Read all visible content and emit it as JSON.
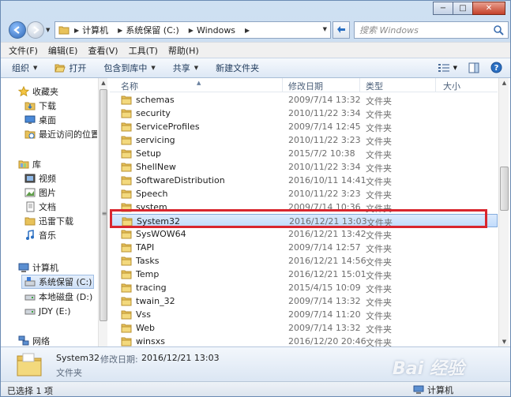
{
  "caption_buttons": {
    "minimize": "−",
    "maximize": "□",
    "close": "✕"
  },
  "address": {
    "crumbs": [
      "计算机",
      "系统保留 (C:)",
      "Windows"
    ]
  },
  "search": {
    "placeholder": "搜索 Windows"
  },
  "menubar": [
    "文件(F)",
    "编辑(E)",
    "查看(V)",
    "工具(T)",
    "帮助(H)"
  ],
  "cmdbar": {
    "organize": "组织",
    "open": "打开",
    "include": "包含到库中",
    "share": "共享",
    "new_folder": "新建文件夹"
  },
  "navpane": {
    "favorites": "收藏夹",
    "fav_items": [
      "下载",
      "桌面",
      "最近访问的位置"
    ],
    "libraries": "库",
    "lib_items": [
      "视频",
      "图片",
      "文档",
      "迅雷下载",
      "音乐"
    ],
    "computer": "计算机",
    "drives": [
      "系统保留 (C:)",
      "本地磁盘 (D:)",
      "JDY (E:)"
    ],
    "network": "网络"
  },
  "columns": {
    "name": "名称",
    "date": "修改日期",
    "type": "类型",
    "size": "大小"
  },
  "files": [
    {
      "name": "schemas",
      "date": "2009/7/14 13:32",
      "type": "文件夹"
    },
    {
      "name": "security",
      "date": "2010/11/22 3:34",
      "type": "文件夹"
    },
    {
      "name": "ServiceProfiles",
      "date": "2009/7/14 12:45",
      "type": "文件夹"
    },
    {
      "name": "servicing",
      "date": "2010/11/22 3:23",
      "type": "文件夹"
    },
    {
      "name": "Setup",
      "date": "2015/7/2 10:38",
      "type": "文件夹"
    },
    {
      "name": "ShellNew",
      "date": "2010/11/22 3:34",
      "type": "文件夹"
    },
    {
      "name": "SoftwareDistribution",
      "date": "2016/10/11 14:41",
      "type": "文件夹"
    },
    {
      "name": "Speech",
      "date": "2010/11/22 3:23",
      "type": "文件夹"
    },
    {
      "name": "system",
      "date": "2009/7/14 10:36",
      "type": "文件夹"
    },
    {
      "name": "System32",
      "date": "2016/12/21 13:03",
      "type": "文件夹"
    },
    {
      "name": "SysWOW64",
      "date": "2016/12/21 13:42",
      "type": "文件夹"
    },
    {
      "name": "TAPI",
      "date": "2009/7/14 12:57",
      "type": "文件夹"
    },
    {
      "name": "Tasks",
      "date": "2016/12/21 14:56",
      "type": "文件夹"
    },
    {
      "name": "Temp",
      "date": "2016/12/21 15:01",
      "type": "文件夹"
    },
    {
      "name": "tracing",
      "date": "2015/4/15 10:09",
      "type": "文件夹"
    },
    {
      "name": "twain_32",
      "date": "2009/7/14 13:32",
      "type": "文件夹"
    },
    {
      "name": "Vss",
      "date": "2009/7/14 11:20",
      "type": "文件夹"
    },
    {
      "name": "Web",
      "date": "2009/7/14 13:32",
      "type": "文件夹"
    },
    {
      "name": "winsxs",
      "date": "2016/12/20 20:46",
      "type": "文件夹"
    }
  ],
  "selected_index": 9,
  "details": {
    "name": "System32",
    "modified_label": "修改日期:",
    "modified_value": "2016/12/21 13:03",
    "type": "文件夹"
  },
  "status": {
    "selection": "已选择 1 项",
    "location": "计算机"
  },
  "watermark": "Bai 经验"
}
